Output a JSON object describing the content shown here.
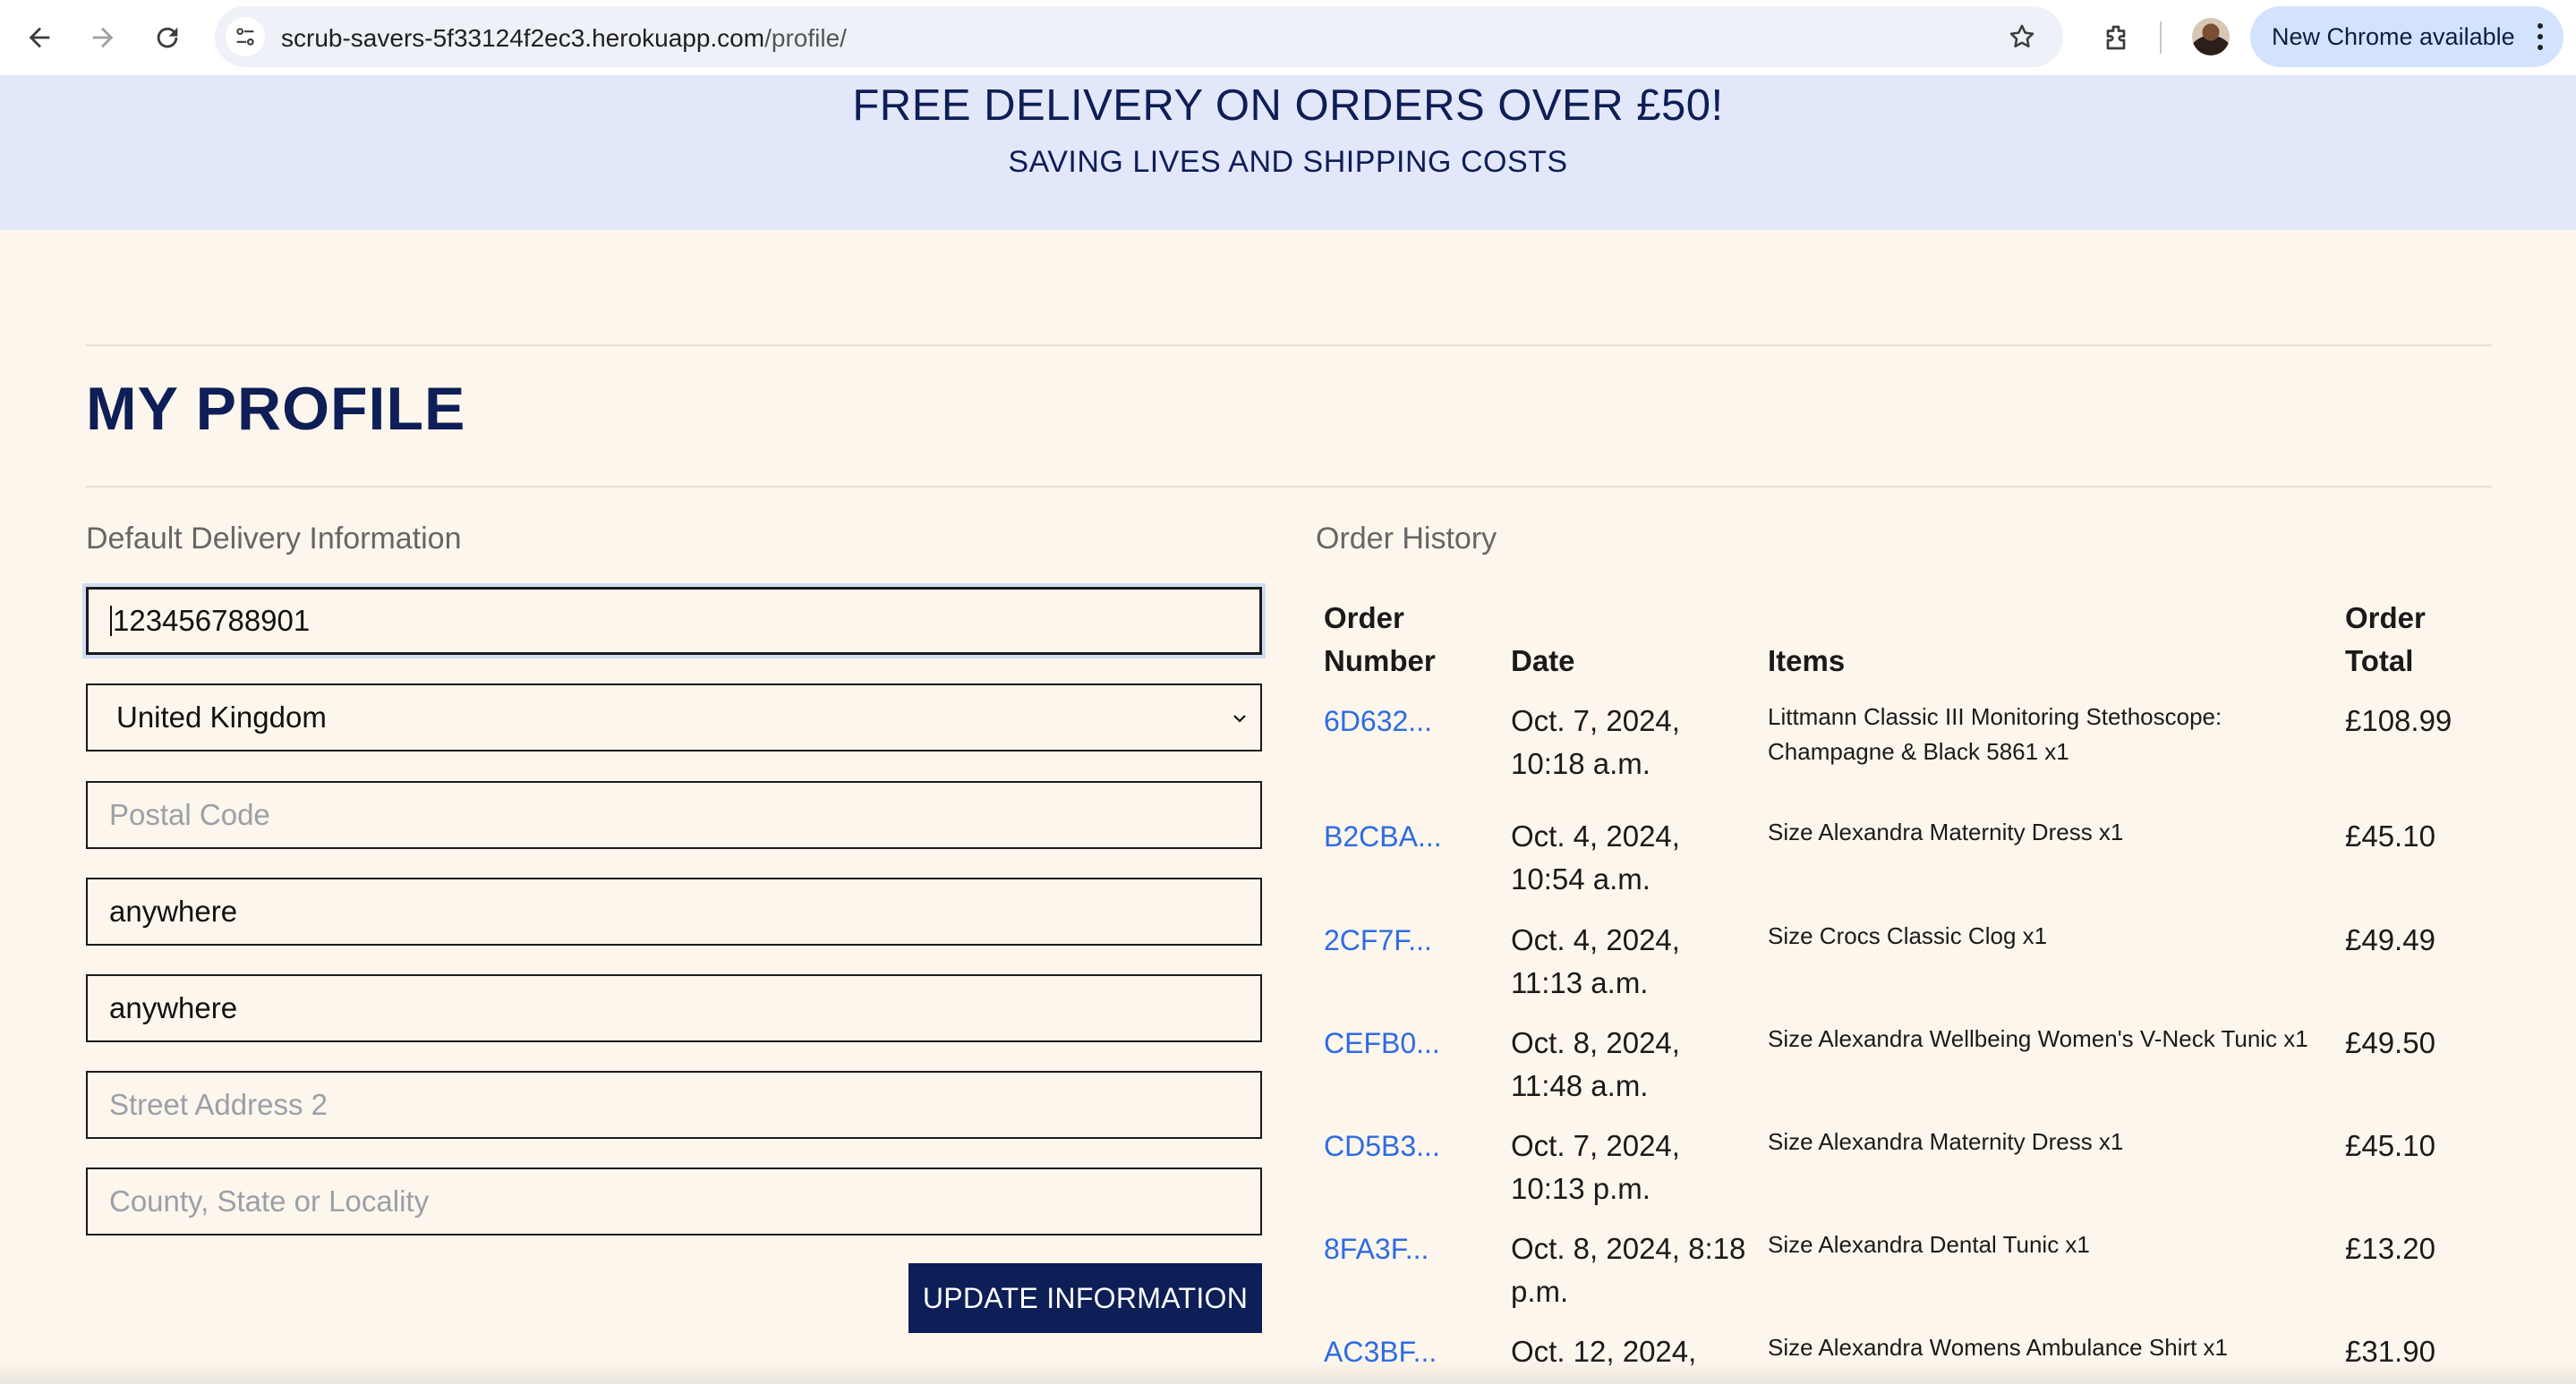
{
  "browser": {
    "url_host": "scrub-savers-5f33124f2ec3.herokuapp.com",
    "url_path": "/profile/",
    "chrome_update_label": "New Chrome available",
    "icons": [
      "back-arrow-icon",
      "forward-arrow-icon",
      "reload-icon",
      "site-info-icon",
      "bookmark-star-icon",
      "extensions-icon",
      "profile-avatar",
      "kebab-menu-icon"
    ]
  },
  "banner": {
    "title": "FREE DELIVERY ON ORDERS OVER £50!",
    "subtitle": "SAVING LIVES AND SHIPPING COSTS"
  },
  "page": {
    "title": "MY PROFILE"
  },
  "delivery": {
    "heading": "Default Delivery Information",
    "phone_value": "123456788901",
    "country_value": "United Kingdom",
    "postcode_placeholder": "Postal Code",
    "town_value": "anywhere",
    "street1_value": "anywhere",
    "street2_placeholder": "Street Address 2",
    "county_placeholder": "County, State or Locality",
    "update_button": "UPDATE INFORMATION"
  },
  "orders": {
    "heading": "Order History",
    "columns": {
      "number_line1": "Order",
      "number_line2": "Number",
      "date": "Date",
      "items": "Items",
      "total_line1": "Order",
      "total_line2": "Total"
    },
    "rows": [
      {
        "number": "6D632...",
        "date": "Oct. 7, 2024, 10:18 a.m.",
        "items": "Littmann Classic III Monitoring Stethoscope: Champagne & Black 5861 x1",
        "total": "£108.99"
      },
      {
        "number": "B2CBA...",
        "date": "Oct. 4, 2024, 10:54 a.m.",
        "items": "Size Alexandra Maternity Dress x1",
        "total": "£45.10"
      },
      {
        "number": "2CF7F...",
        "date": "Oct. 4, 2024, 11:13 a.m.",
        "items": "Size Crocs Classic Clog x1",
        "total": "£49.49"
      },
      {
        "number": "CEFB0...",
        "date": "Oct. 8, 2024, 11:48 a.m.",
        "items": "Size Alexandra Wellbeing Women's V-Neck Tunic x1",
        "total": "£49.50"
      },
      {
        "number": "CD5B3...",
        "date": "Oct. 7, 2024, 10:13 p.m.",
        "items": "Size Alexandra Maternity Dress x1",
        "total": "£45.10"
      },
      {
        "number": "8FA3F...",
        "date": "Oct. 8, 2024, 8:18 p.m.",
        "items": "Size Alexandra Dental Tunic x1",
        "total": "£13.20"
      },
      {
        "number": "AC3BF...",
        "date": "Oct. 12, 2024,",
        "items": "Size Alexandra Womens Ambulance Shirt x1",
        "total": "£31.90"
      }
    ]
  }
}
